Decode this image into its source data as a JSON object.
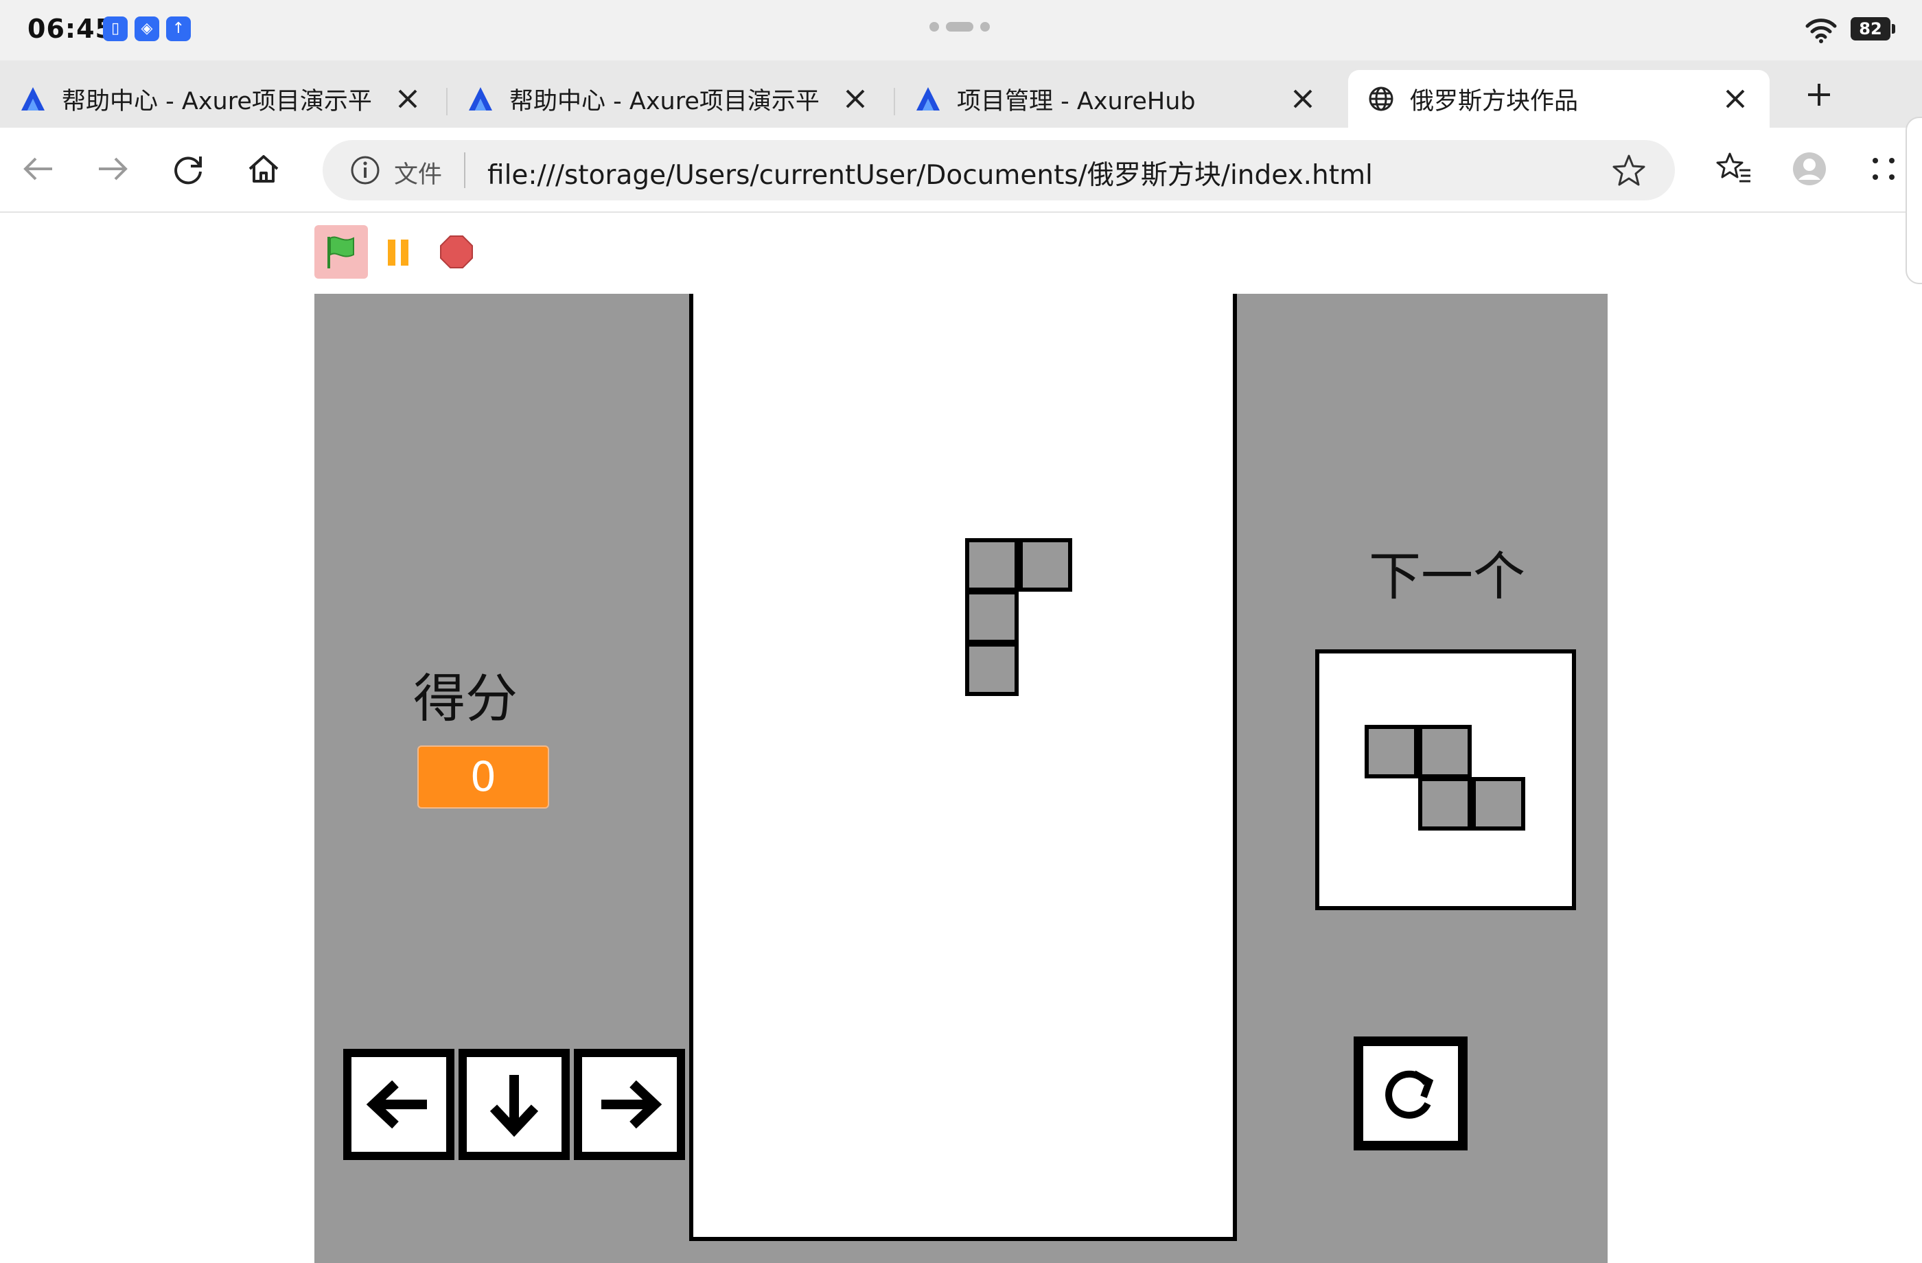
{
  "status": {
    "time": "06:45",
    "battery": "82"
  },
  "tabs": [
    {
      "title": "帮助中心 - Axure项目演示平",
      "icon": "axure-logo-icon"
    },
    {
      "title": "帮助中心 - Axure项目演示平",
      "icon": "axure-logo-icon"
    },
    {
      "title": "项目管理 - AxureHub",
      "icon": "axure-logo-icon"
    },
    {
      "title": "俄罗斯方块作品",
      "icon": "globe-icon",
      "active": true
    }
  ],
  "toolbar": {
    "url_scheme_label": "文件",
    "url": "file:///storage/Users/currentUser/Documents/俄罗斯方块/index.html"
  },
  "game": {
    "score_label": "得分",
    "score": "0",
    "next_label": "下一个",
    "accent_color": "#ff8c1a",
    "current_piece": "J",
    "next_piece": "Z"
  }
}
